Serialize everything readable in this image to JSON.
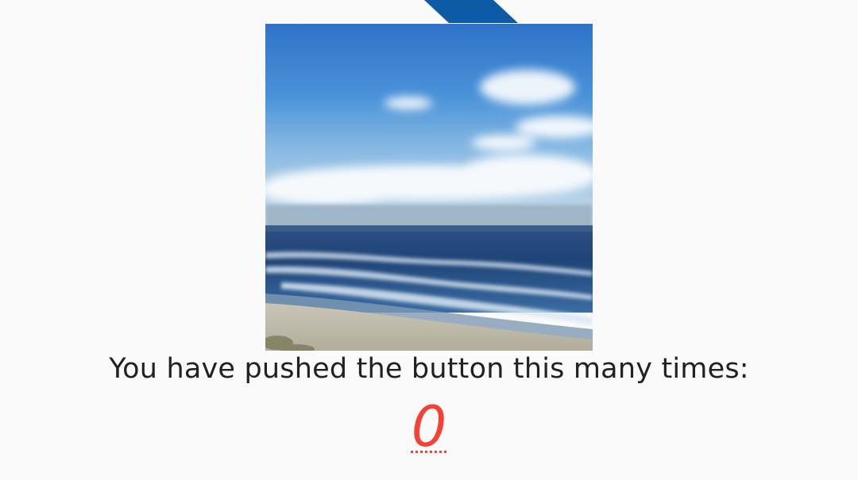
{
  "main": {
    "prompt_text": "You have pushed the button this many times:",
    "counter_value": "0",
    "counter_color": "#f44336",
    "accent_color": "#0d5aa7"
  },
  "image": {
    "icon": "ocean-beach-photo"
  }
}
